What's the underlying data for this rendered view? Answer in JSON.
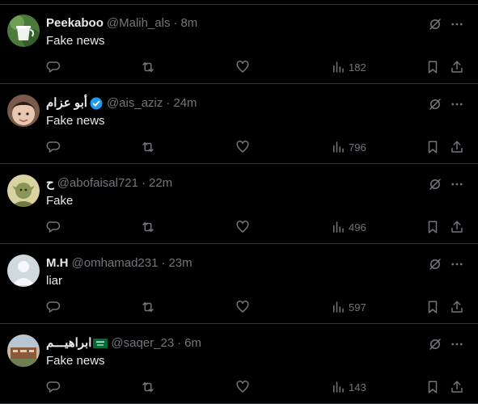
{
  "tweets": [
    {
      "name": "Peekaboo",
      "handle": "@Malih_als",
      "separator": "·",
      "time": "8m",
      "text": "Fake news",
      "views": "182",
      "verified": false,
      "flag": false
    },
    {
      "name": "أبو عزام",
      "handle": "@ais_aziz",
      "separator": "·",
      "time": "24m",
      "text": "Fake news",
      "views": "796",
      "verified": true,
      "flag": false
    },
    {
      "name": "ح",
      "handle": "@abofaisal721",
      "separator": "·",
      "time": "22m",
      "text": "Fake",
      "views": "496",
      "verified": false,
      "flag": false
    },
    {
      "name": "M.H",
      "handle": "@omhamad231",
      "separator": "·",
      "time": "23m",
      "text": "liar",
      "views": "597",
      "verified": false,
      "flag": false
    },
    {
      "name": "ابراهيـــم",
      "handle": "@saqer_23",
      "separator": "·",
      "time": "6m",
      "text": "Fake news",
      "views": "143",
      "verified": false,
      "flag": true
    }
  ],
  "icons": {
    "reply": "reply-icon",
    "repost": "repost-icon",
    "like": "heart-icon",
    "views": "views-icon",
    "bookmark": "bookmark-icon",
    "share": "share-icon",
    "grok": "grok-icon",
    "more": "more-icon"
  },
  "colors": {
    "background": "#000000",
    "text": "#e7e9ea",
    "secondary": "#71767b",
    "divider": "#2f3336",
    "verified": "#1d9bf0",
    "flag": "#006c35"
  }
}
